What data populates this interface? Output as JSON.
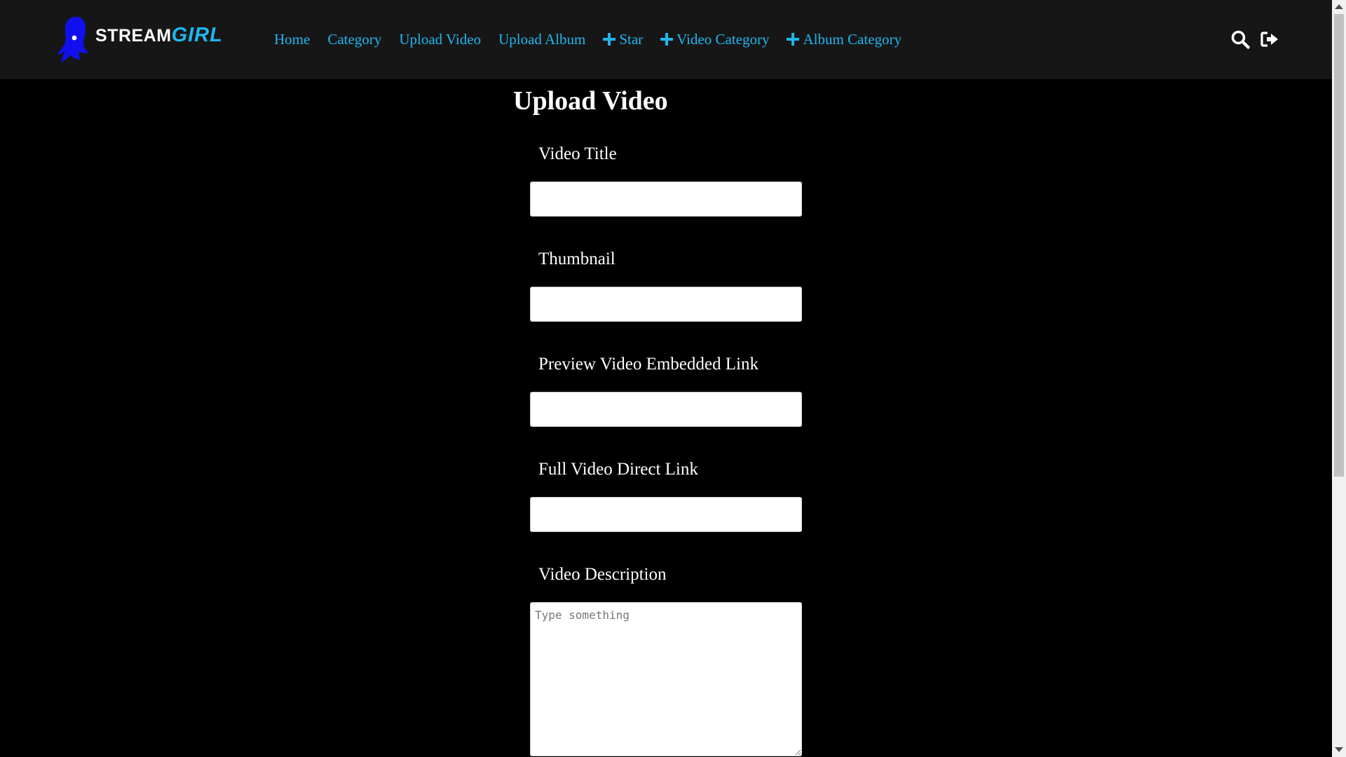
{
  "brand": {
    "name_part1": "STREAM",
    "name_part2": "GIRL",
    "accent_color": "#1fb6ef",
    "logo_color": "#1010ee"
  },
  "nav": {
    "home": "Home",
    "category": "Category",
    "upload_video": "Upload Video",
    "upload_album": "Upload Album",
    "star": "Star",
    "video_category": "Video Category",
    "album_category": "Album Category"
  },
  "header_icons": [
    "search-icon",
    "sign-out-icon"
  ],
  "page": {
    "title": "Upload Video"
  },
  "form": {
    "video_title_label": "Video Title",
    "video_title_value": "",
    "thumbnail_label": "Thumbnail",
    "thumbnail_value": "",
    "preview_label": "Preview Video Embedded Link",
    "preview_value": "",
    "full_label": "Full Video Direct Link",
    "full_value": "",
    "description_label": "Video Description",
    "description_placeholder": "Type something"
  }
}
